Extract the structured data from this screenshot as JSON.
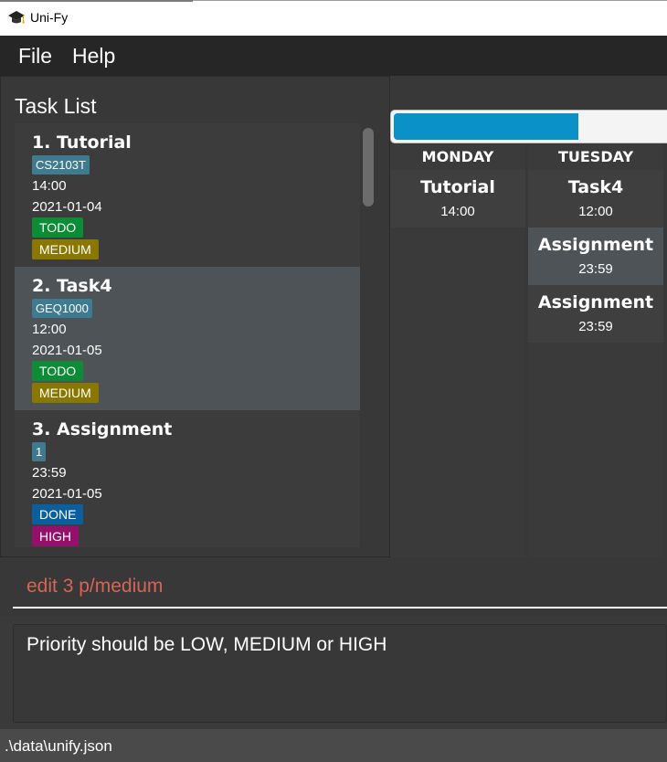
{
  "window": {
    "title": "Uni-Fy",
    "icon": "graduation-cap-icon"
  },
  "menu": {
    "file_label": "File",
    "help_label": "Help"
  },
  "task_list": {
    "title": "Task List",
    "tasks": [
      {
        "index_name": "1.  Tutorial",
        "tag": "CS2103T",
        "time": "14:00",
        "date": "2021-01-04",
        "state": "TODO",
        "priority": "MEDIUM",
        "state_color": "#0b8c35",
        "priority_color": "#8a7700"
      },
      {
        "index_name": "2.  Task4",
        "tag": "GEQ1000",
        "time": "12:00",
        "date": "2021-01-05",
        "state": "TODO",
        "priority": "MEDIUM",
        "state_color": "#0b8c35",
        "priority_color": "#8a7700"
      },
      {
        "index_name": "3.  Assignment",
        "tag": "1",
        "time": "23:59",
        "date": "2021-01-05",
        "state": "DONE",
        "priority": "HIGH",
        "state_color": "#0a5f9c",
        "priority_color": "#93106b"
      }
    ]
  },
  "weekly_progress": {
    "fraction": 0.67,
    "fill_color": "#0a92c8"
  },
  "calendar": {
    "days": [
      {
        "label": "MONDAY",
        "slots": [
          {
            "name": "Tutorial",
            "time": "14:00"
          }
        ]
      },
      {
        "label": "TUESDAY",
        "slots": [
          {
            "name": "Task4",
            "time": "12:00"
          },
          {
            "name": "Assignment",
            "time": "23:59"
          },
          {
            "name": "Assignment",
            "time": "23:59"
          }
        ]
      }
    ]
  },
  "command": {
    "value": "edit 3 p/medium",
    "text_color": "#d96455"
  },
  "result": {
    "message": "Priority should be LOW, MEDIUM or HIGH"
  },
  "status": {
    "path": ".\\data\\unify.json"
  }
}
